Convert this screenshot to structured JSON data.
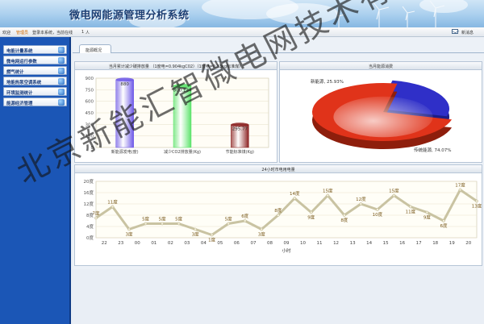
{
  "header": {
    "title": "微电网能源管理分析系统",
    "welcome_prefix": "欢迎",
    "user": "管理员",
    "login_text": "登录本系统，当前在线",
    "online_count": "1",
    "online_suffix": "人",
    "new_mail": "新消息"
  },
  "sidebar": {
    "items": [
      {
        "label": "电能计量系统",
        "icon": "gauge-icon"
      },
      {
        "label": "微电网运行参数",
        "icon": "grid-params-icon"
      },
      {
        "label": "燃气统计",
        "icon": "gas-icon"
      },
      {
        "label": "地能热泵空调系统",
        "icon": "heat-pump-icon"
      },
      {
        "label": "环境监测统计",
        "icon": "environment-icon"
      },
      {
        "label": "能源经济管理",
        "icon": "economy-icon"
      }
    ]
  },
  "tabs": [
    {
      "label": "能源概况"
    }
  ],
  "panels": {
    "reduction_title": "当月累计减少碳排放量  （1度电=0.904kgC02）（1度电=0.33kg标准煤）",
    "energy_title": "当月能源消费",
    "hourly_title": "24小时市电用电量"
  },
  "chart_data": [
    {
      "type": "bar",
      "categories": [
        "新能源发电(度)",
        "减少CO2排放量(Kg)",
        "节能标准煤(Kg)"
      ],
      "values": [
        880,
        800,
        295.77
      ],
      "value_labels": [
        "880",
        "800.134",
        "295.77"
      ],
      "ylim": [
        0,
        900
      ],
      "yticks": [
        0,
        150,
        300,
        450,
        600,
        750,
        900
      ],
      "colors": [
        "#6d58e8",
        "#5ae36a",
        "#8a1f1f"
      ],
      "title": ""
    },
    {
      "type": "pie",
      "slices": [
        {
          "name": "新能源",
          "value": 25.93,
          "label": "新能源, 25.93%",
          "color": "#2f2fc8"
        },
        {
          "name": "传统能源",
          "value": 74.07,
          "label": "传统能源, 74.07%",
          "color": "#e0331a"
        }
      ]
    },
    {
      "type": "line",
      "x": [
        "22",
        "23",
        "00",
        "01",
        "02",
        "03",
        "04",
        "05",
        "06",
        "07",
        "08",
        "09",
        "10",
        "11",
        "12",
        "13",
        "14",
        "15",
        "16",
        "17",
        "18",
        "19",
        "20"
      ],
      "values": [
        7,
        11,
        3,
        5,
        5,
        5,
        3,
        1,
        5,
        6,
        3,
        8,
        14,
        9,
        15,
        8,
        12,
        10,
        15,
        11,
        9,
        6,
        17,
        13
      ],
      "value_labels": [
        "7度",
        "11度",
        "3度",
        "5度",
        "5度",
        "5度",
        "3度",
        "1度",
        "5度",
        "6度",
        "3度",
        "8度",
        "14度",
        "9度",
        "15度",
        "8度",
        "12度",
        "10度",
        "15度",
        "11度",
        "9度",
        "6度",
        "17度",
        "13度"
      ],
      "ylim": [
        0,
        20
      ],
      "ytick_labels": [
        "0度",
        "4度",
        "8度",
        "12度",
        "16度",
        "20度"
      ],
      "xlabel": "小时",
      "line_color": "#c9c3a2"
    }
  ],
  "watermark": "北京新能汇智微电网技术有限公司"
}
